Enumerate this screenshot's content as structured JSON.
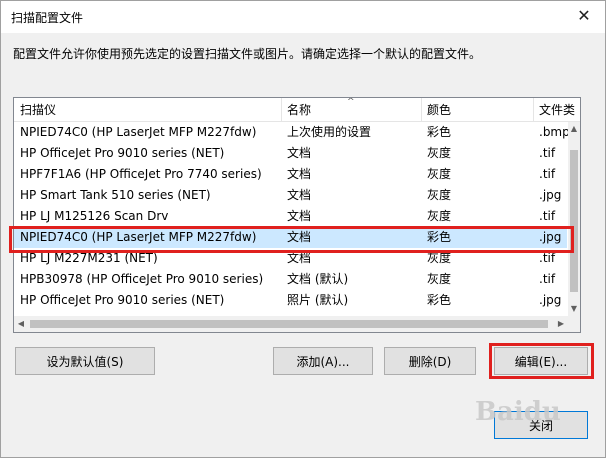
{
  "window": {
    "title": "扫描配置文件",
    "close_glyph": "✕"
  },
  "description": "配置文件允许你使用预先选定的设置扫描文件或图片。请确定选择一个默认的配置文件。",
  "table": {
    "columns": [
      "扫描仪",
      "名称",
      "颜色",
      "文件类"
    ],
    "sort_indicator": "^",
    "rows": [
      {
        "scanner": "NPIED74C0 (HP LaserJet MFP M227fdw)",
        "name": "上次使用的设置",
        "color": "彩色",
        "filetype": ".bmp"
      },
      {
        "scanner": "HP OfficeJet Pro 9010 series (NET)",
        "name": "文档",
        "color": "灰度",
        "filetype": ".tif"
      },
      {
        "scanner": "HPF7F1A6 (HP OfficeJet Pro 7740 series)",
        "name": "文档",
        "color": "灰度",
        "filetype": ".tif"
      },
      {
        "scanner": "HP Smart Tank 510 series (NET)",
        "name": "文档",
        "color": "灰度",
        "filetype": ".jpg"
      },
      {
        "scanner": "HP LJ M125126 Scan Drv",
        "name": "文档",
        "color": "灰度",
        "filetype": ".tif"
      },
      {
        "scanner": "NPIED74C0 (HP LaserJet MFP M227fdw)",
        "name": "文档",
        "color": "彩色",
        "filetype": ".jpg"
      },
      {
        "scanner": "HP LJ M227M231 (NET)",
        "name": "文档",
        "color": "灰度",
        "filetype": ".tif"
      },
      {
        "scanner": "HPB30978 (HP OfficeJet Pro 9010 series)",
        "name": "文档 (默认)",
        "color": "灰度",
        "filetype": ".tif"
      },
      {
        "scanner": "HP OfficeJet Pro 9010 series (NET)",
        "name": "照片 (默认)",
        "color": "彩色",
        "filetype": ".jpg"
      }
    ],
    "selected_row": 5
  },
  "buttons": {
    "set_default": "设为默认值(S)",
    "add": "添加(A)...",
    "delete": "删除(D)",
    "edit": "编辑(E)...",
    "close": "关闭"
  },
  "watermark": "Baidu",
  "colors": {
    "highlight": "#e0201e",
    "selection": "#cce8ff"
  }
}
